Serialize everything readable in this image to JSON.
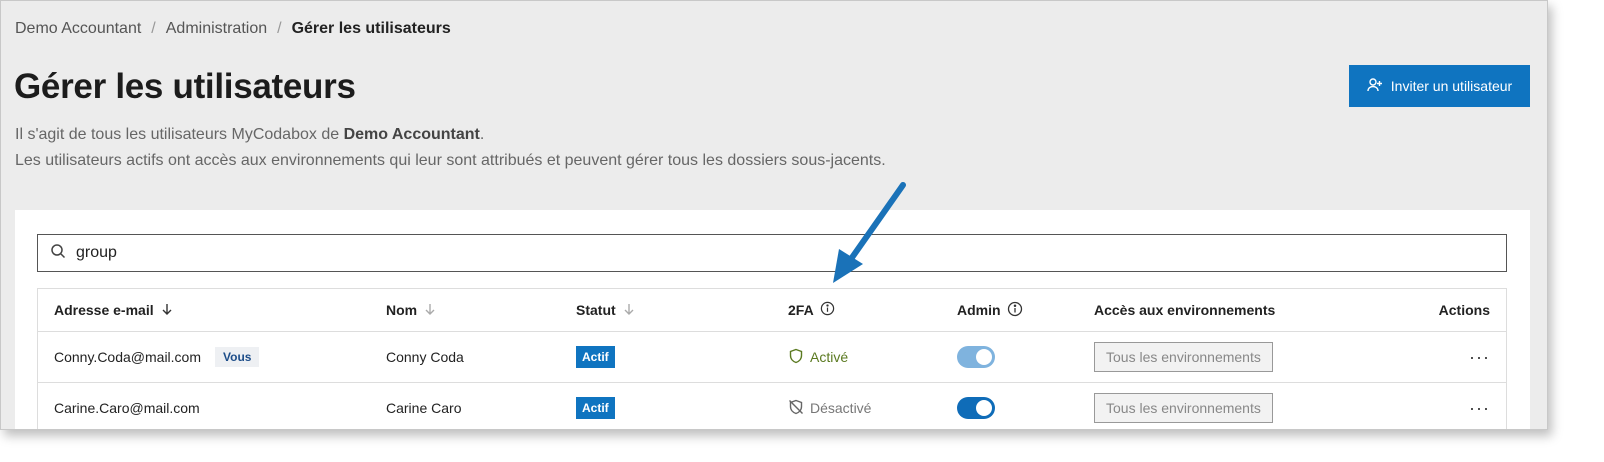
{
  "breadcrumb": {
    "items": [
      "Demo Accountant",
      "Administration"
    ],
    "current": "Gérer les utilisateurs",
    "separator": "/"
  },
  "page": {
    "title": "Gérer les utilisateurs",
    "desc_line1_prefix": "Il s'agit de tous les utilisateurs MyCodabox de ",
    "desc_line1_bold": "Demo Accountant",
    "desc_line1_suffix": ".",
    "desc_line2": "Les utilisateurs actifs ont accès aux environnements qui leur sont attribués et peuvent gérer tous les dossiers sous-jacents."
  },
  "toolbar": {
    "invite_label": "Inviter un utilisateur"
  },
  "search": {
    "value": "group"
  },
  "table": {
    "headers": {
      "email": "Adresse e-mail",
      "nom": "Nom",
      "statut": "Statut",
      "twofa": "2FA",
      "admin": "Admin",
      "acces": "Accès aux environnements",
      "actions": "Actions"
    },
    "rows": [
      {
        "email": "Conny.Coda@mail.com",
        "you_badge": "Vous",
        "nom": "Conny Coda",
        "statut": "Actif",
        "twofa": "Activé",
        "admin_on": true,
        "acces": "Tous les environnements",
        "actions": "···"
      },
      {
        "email": "Carine.Caro@mail.com",
        "nom": "Carine Caro",
        "statut": "Actif",
        "twofa": "Désactivé",
        "admin_on": true,
        "acces": "Tous les environnements",
        "actions": "···"
      }
    ]
  },
  "colors": {
    "accent": "#0f74c0",
    "twofa_on": "#5b7a21",
    "annotation_arrow": "#1a72b8"
  },
  "icons": [
    "user-plus-icon",
    "search-icon",
    "sort-down-icon",
    "info-icon",
    "shield-icon",
    "shield-off-icon",
    "more-horizontal-icon",
    "annotation-arrow"
  ]
}
